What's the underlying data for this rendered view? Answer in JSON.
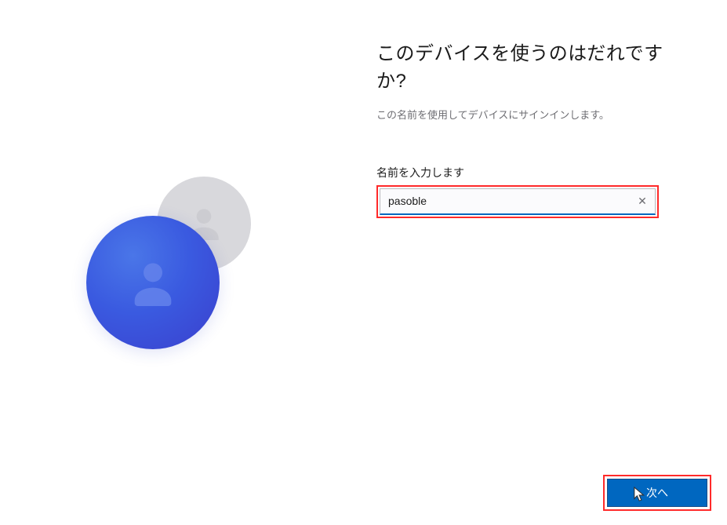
{
  "heading": "このデバイスを使うのはだれですか?",
  "subheading": "この名前を使用してデバイスにサインインします。",
  "input": {
    "label": "名前を入力します",
    "value": "pasoble"
  },
  "buttons": {
    "next": "次へ"
  }
}
